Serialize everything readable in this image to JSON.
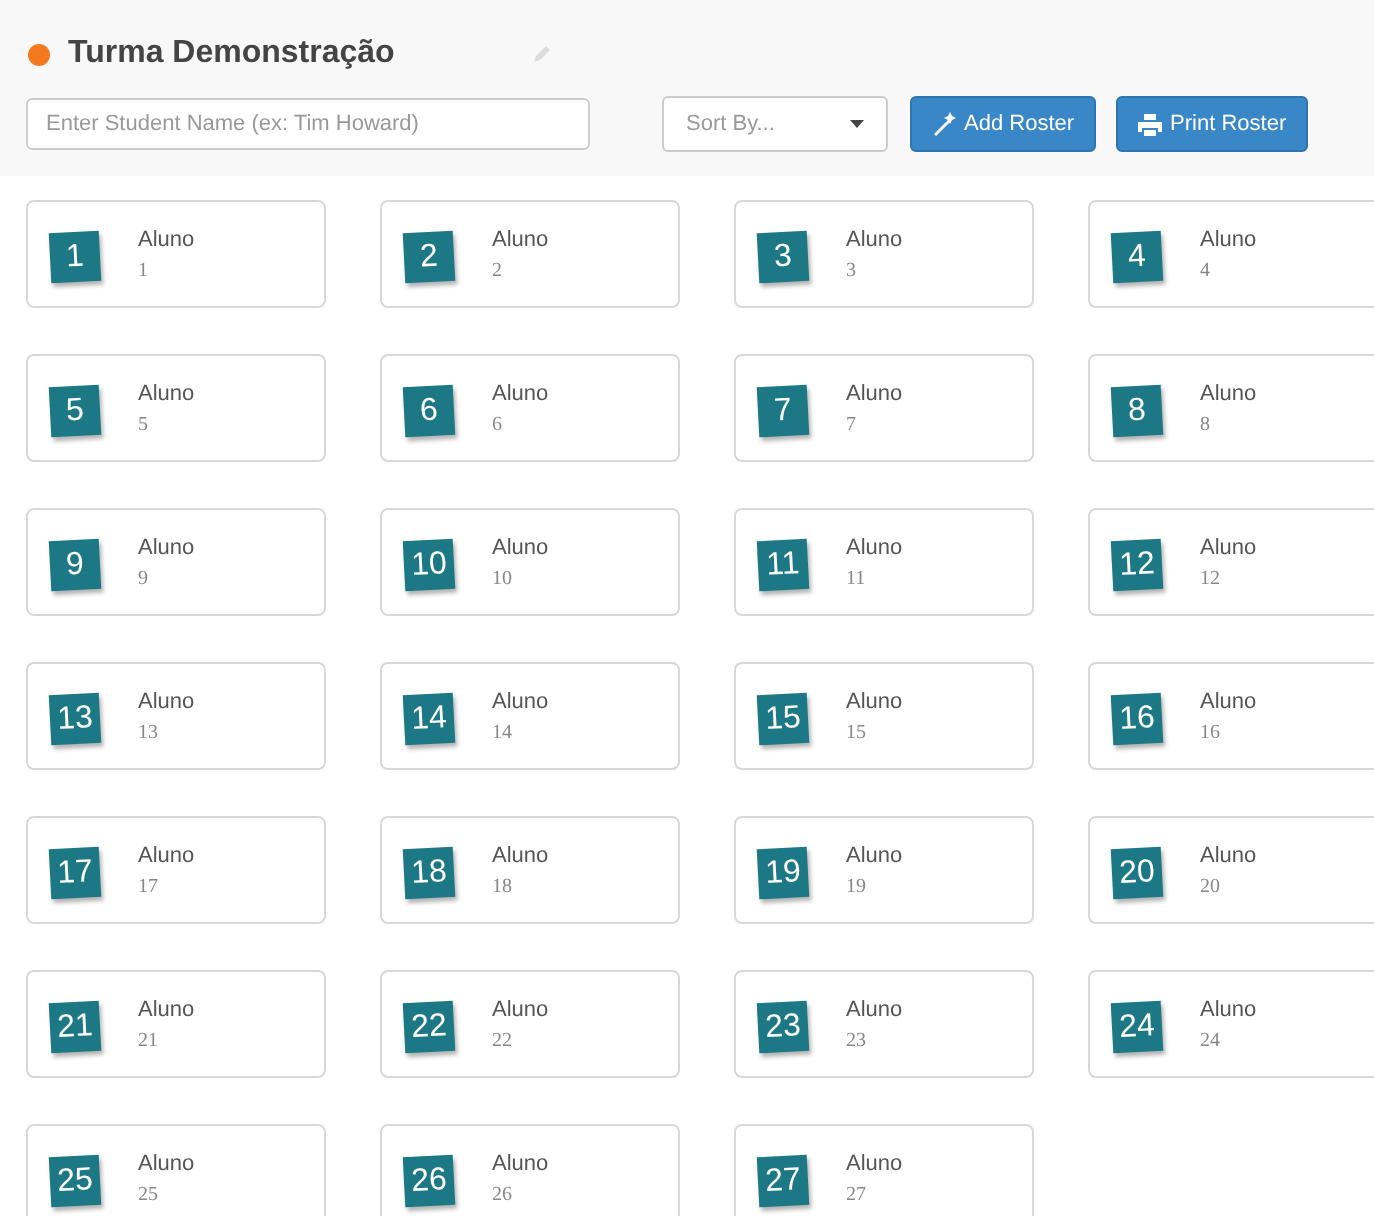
{
  "class_title": "Turma Demonstração",
  "search": {
    "placeholder": "Enter Student Name (ex: Tim Howard)"
  },
  "sort": {
    "placeholder": "Sort By..."
  },
  "buttons": [
    {
      "label": "Add Roster",
      "kind": "wand"
    },
    {
      "label": "Print Roster",
      "kind": "print"
    }
  ],
  "students": [
    {
      "badge": "1",
      "first_name": "Aluno",
      "last_name": "1"
    },
    {
      "badge": "2",
      "first_name": "Aluno",
      "last_name": "2"
    },
    {
      "badge": "3",
      "first_name": "Aluno",
      "last_name": "3"
    },
    {
      "badge": "4",
      "first_name": "Aluno",
      "last_name": "4"
    },
    {
      "badge": "5",
      "first_name": "Aluno",
      "last_name": "5"
    },
    {
      "badge": "6",
      "first_name": "Aluno",
      "last_name": "6"
    },
    {
      "badge": "7",
      "first_name": "Aluno",
      "last_name": "7"
    },
    {
      "badge": "8",
      "first_name": "Aluno",
      "last_name": "8"
    },
    {
      "badge": "9",
      "first_name": "Aluno",
      "last_name": "9"
    },
    {
      "badge": "10",
      "first_name": "Aluno",
      "last_name": "10"
    },
    {
      "badge": "11",
      "first_name": "Aluno",
      "last_name": "11"
    },
    {
      "badge": "12",
      "first_name": "Aluno",
      "last_name": "12"
    },
    {
      "badge": "13",
      "first_name": "Aluno",
      "last_name": "13"
    },
    {
      "badge": "14",
      "first_name": "Aluno",
      "last_name": "14"
    },
    {
      "badge": "15",
      "first_name": "Aluno",
      "last_name": "15"
    },
    {
      "badge": "16",
      "first_name": "Aluno",
      "last_name": "16"
    },
    {
      "badge": "17",
      "first_name": "Aluno",
      "last_name": "17"
    },
    {
      "badge": "18",
      "first_name": "Aluno",
      "last_name": "18"
    },
    {
      "badge": "19",
      "first_name": "Aluno",
      "last_name": "19"
    },
    {
      "badge": "20",
      "first_name": "Aluno",
      "last_name": "20"
    },
    {
      "badge": "21",
      "first_name": "Aluno",
      "last_name": "21"
    },
    {
      "badge": "22",
      "first_name": "Aluno",
      "last_name": "22"
    },
    {
      "badge": "23",
      "first_name": "Aluno",
      "last_name": "23"
    },
    {
      "badge": "24",
      "first_name": "Aluno",
      "last_name": "24"
    },
    {
      "badge": "25",
      "first_name": "Aluno",
      "last_name": "25"
    },
    {
      "badge": "26",
      "first_name": "Aluno",
      "last_name": "26"
    },
    {
      "badge": "27",
      "first_name": "Aluno",
      "last_name": "27"
    }
  ]
}
